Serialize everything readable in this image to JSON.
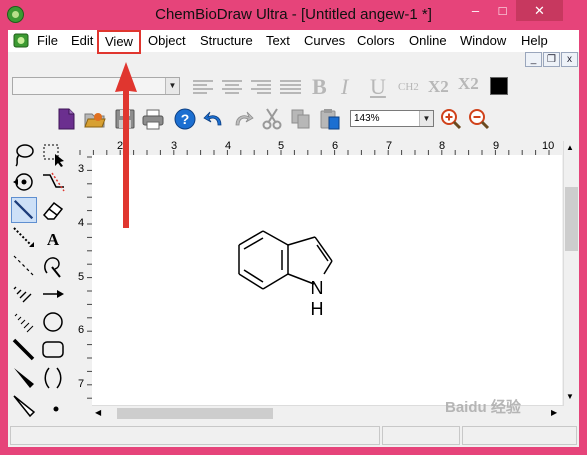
{
  "window": {
    "title": "ChemBioDraw Ultra - [Untitled angew-1 *]",
    "controls": {
      "minimize": "–",
      "maximize": "□",
      "close": "✕"
    }
  },
  "menubar": {
    "items": [
      "File",
      "Edit",
      "View",
      "Object",
      "Structure",
      "Text",
      "Curves",
      "Colors",
      "Online",
      "Window",
      "Help"
    ],
    "highlighted": "View",
    "mdi_controls": {
      "minimize": "_",
      "restore": "❐",
      "close": "x"
    }
  },
  "format_toolbar": {
    "font_combo": "",
    "size_combo": "",
    "bold": "B",
    "italic": "I",
    "underline": "U",
    "ch2": "CH2",
    "subscript": "X2",
    "superscript": "X2",
    "color": "#000000"
  },
  "general_toolbar": {
    "zoom": "143%"
  },
  "rulers": {
    "top_ticks": [
      "2",
      "3",
      "4",
      "5",
      "6",
      "7",
      "8",
      "9",
      "10"
    ],
    "left_ticks": [
      "3",
      "4",
      "5",
      "6",
      "7"
    ]
  },
  "molecule": {
    "name": "indole",
    "atom_labels": {
      "nitrogen": "N",
      "hydrogen": "H"
    }
  },
  "annotation": {
    "color": "#e0362f"
  },
  "watermark": {
    "text": "Baidu 经验"
  }
}
